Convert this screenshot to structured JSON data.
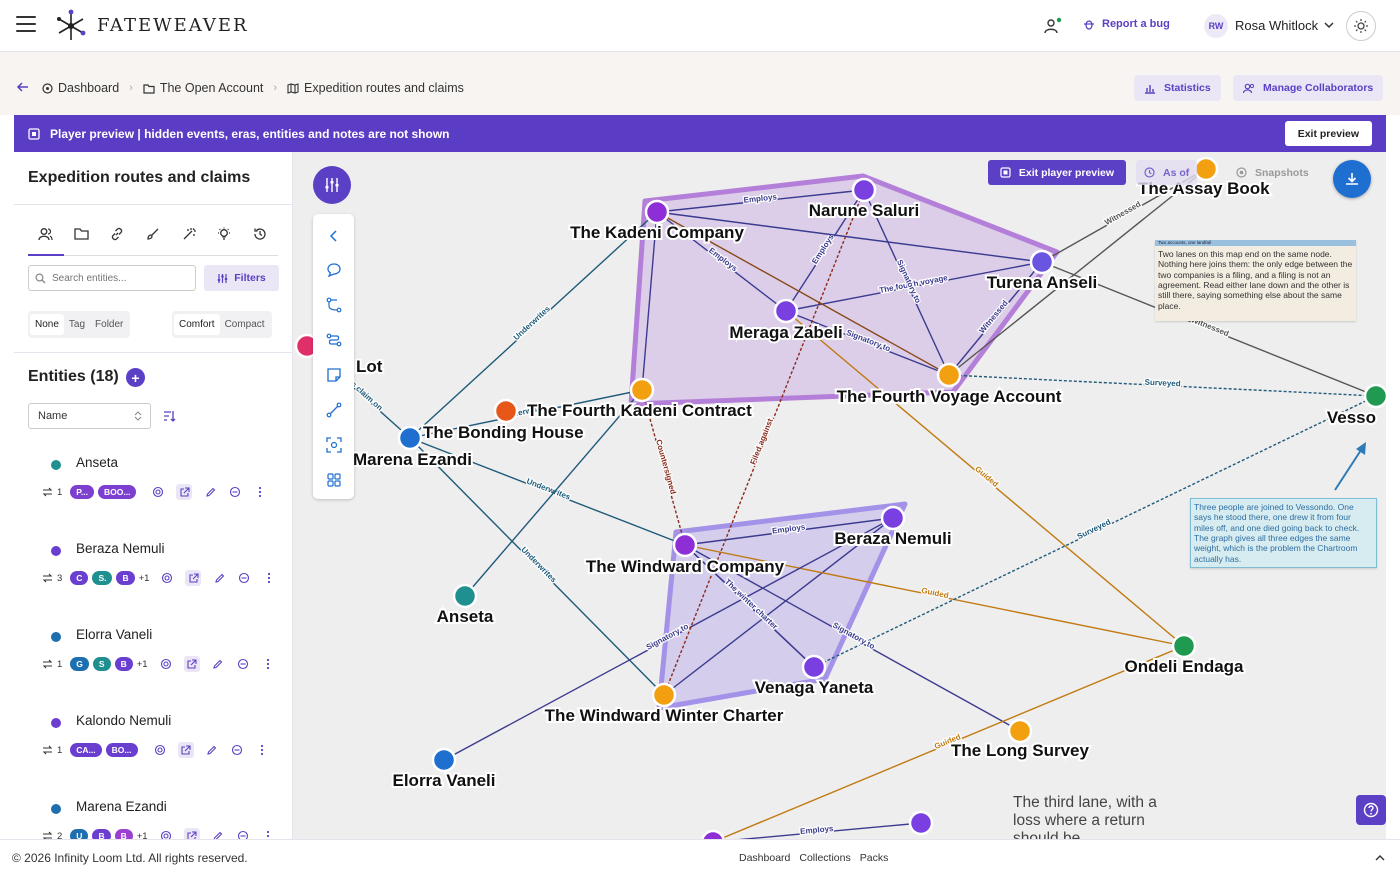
{
  "app": {
    "name": "FATEWEAVER",
    "user_initials": "RW",
    "user_name": "Rosa Whitlock",
    "report_bug": "Report a bug"
  },
  "breadcrumb": {
    "items": [
      "Dashboard",
      "The Open Account",
      "Expedition routes and claims"
    ],
    "statistics": "Statistics",
    "manage_collaborators": "Manage Collaborators"
  },
  "banner": {
    "text": "Player preview | hidden events, eras, entities and notes are not shown",
    "exit_label": "Exit preview"
  },
  "sidebar": {
    "title": "Expedition routes and claims",
    "search_placeholder": "Search entities...",
    "filters_label": "Filters",
    "group_options": [
      "None",
      "Tag",
      "Folder"
    ],
    "group_selected": "None",
    "density_options": [
      "Comfort",
      "Compact"
    ],
    "density_selected": "Comfort",
    "entities_heading": "Entities (18)",
    "sort_value": "Name",
    "entities": [
      {
        "name": "Anseta",
        "color": "#1f8f8f",
        "links": "1",
        "pills": [
          {
            "text": "P...",
            "color": "#7c3fd0"
          },
          {
            "text": "BOO...",
            "color": "#7c3fd0"
          }
        ],
        "more": ""
      },
      {
        "name": "Beraza Nemuli",
        "color": "#6a3fd0",
        "links": "3",
        "pills": [
          {
            "text": "C",
            "color": "#6a3fd0"
          },
          {
            "text": "S.",
            "color": "#1f8f8f"
          },
          {
            "text": "B",
            "color": "#6a3fd0"
          }
        ],
        "more": "+1"
      },
      {
        "name": "Elorra Vaneli",
        "color": "#1e6fb0",
        "links": "1",
        "pills": [
          {
            "text": "G",
            "color": "#1e6fb0"
          },
          {
            "text": "S",
            "color": "#1f8f8f"
          },
          {
            "text": "B",
            "color": "#6a3fd0"
          }
        ],
        "more": "+1"
      },
      {
        "name": "Kalondo Nemuli",
        "color": "#6a3fd0",
        "links": "1",
        "pills": [
          {
            "text": "CA...",
            "color": "#6a3fd0"
          },
          {
            "text": "BO...",
            "color": "#6a3fd0"
          }
        ],
        "more": ""
      },
      {
        "name": "Marena Ezandi",
        "color": "#1e6fb0",
        "links": "2",
        "pills": [
          {
            "text": "U",
            "color": "#1e6fb0"
          },
          {
            "text": "B",
            "color": "#6a3fd0"
          },
          {
            "text": "B",
            "color": "#9b3fd0"
          }
        ],
        "more": "+1"
      }
    ]
  },
  "canvas": {
    "exit_player_preview": "Exit player preview",
    "as_of": "As of",
    "snapshots": "Snapshots",
    "note1_header": "Two accounts, one landfall",
    "note1_text": "Two lanes on this map end on the same node. Nothing here joins them: the only edge between the two companies is a filing, and a filing is not an agreement. Read either lane down and the other is still there, saying something else about the same place.",
    "note2_text": "Three people are joined to Vessondo. One says he stood there, one drew it from four miles off, and one died going back to check. The graph gives all three edges the same weight, which is the problem the Chartroom actually has.",
    "big_note": "The third lane, with a loss where a return should be",
    "nodes": [
      {
        "id": "kadeni",
        "label": "The Kadeni Company",
        "color": "#8e2ed6"
      },
      {
        "id": "narune",
        "label": "Narune Saluri",
        "color": "#7a3fe0"
      },
      {
        "id": "turena",
        "label": "Turena Anseli",
        "color": "#6a55e0"
      },
      {
        "id": "meraga",
        "label": "Meraga Zabeli",
        "color": "#7a3fe0"
      },
      {
        "id": "fourthcontract",
        "label": "The Fourth Kadeni Contract",
        "color": "#f2a010"
      },
      {
        "id": "fourthvoyage",
        "label": "The Fourth Voyage Account",
        "color": "#f2a010"
      },
      {
        "id": "assay",
        "label": "The Assay Book",
        "color": "#f2a010"
      },
      {
        "id": "vesso",
        "label": "Vesso",
        "color": "#1f9a50"
      },
      {
        "id": "bonding",
        "label": "The Bonding House",
        "color": "#1e6fd0"
      },
      {
        "id": "marena",
        "label": "Marena Ezandi",
        "color": "#1e6fd0"
      },
      {
        "id": "orange",
        "label": "",
        "color": "#e8571a"
      },
      {
        "id": "pink",
        "label": "",
        "color": "#e0306a"
      },
      {
        "id": "lot",
        "label": "Lot",
        "color": ""
      },
      {
        "id": "windward",
        "label": "The Windward Company",
        "color": "#8e2ed6"
      },
      {
        "id": "beraza",
        "label": "Beraza Nemuli",
        "color": "#7a3fe0"
      },
      {
        "id": "venaga",
        "label": "Venaga Yaneta",
        "color": "#7a3fe0"
      },
      {
        "id": "winter",
        "label": "The Windward Winter Charter",
        "color": "#f2a010"
      },
      {
        "id": "anseta",
        "label": "Anseta",
        "color": "#1f8f8f"
      },
      {
        "id": "ondeli",
        "label": "Ondeli Endaga",
        "color": "#1f9a50"
      },
      {
        "id": "longsurvey",
        "label": "The Long Survey",
        "color": "#f2a010"
      },
      {
        "id": "elorra",
        "label": "Elorra Vaneli",
        "color": "#1e6fd0"
      },
      {
        "id": "bottomA",
        "label": "",
        "color": "#7a3fe0"
      },
      {
        "id": "bottomB",
        "label": "",
        "color": "#8e2ed6"
      }
    ],
    "edges": [
      {
        "from": "kadeni",
        "to": "narune",
        "label": "Employs",
        "color": "#3b3b8f"
      },
      {
        "from": "narune",
        "to": "meraga",
        "label": "Employs",
        "color": "#3b3b8f"
      },
      {
        "from": "kadeni",
        "to": "turena",
        "label": "",
        "color": "#3b3b8f"
      },
      {
        "from": "kadeni",
        "to": "meraga",
        "label": "Employs",
        "color": "#3b3b8f"
      },
      {
        "from": "meraga",
        "to": "turena",
        "label": "The fourth voyage",
        "color": "#3b3b8f"
      },
      {
        "from": "narune",
        "to": "fourthvoyage",
        "label": "Signatory to",
        "color": "#3b3b8f"
      },
      {
        "from": "meraga",
        "to": "fourthvoyage",
        "label": "Signatory to",
        "color": "#3b3b8f"
      },
      {
        "from": "turena",
        "to": "fourthvoyage",
        "label": "Witnessed",
        "color": "#3b3b8f"
      },
      {
        "from": "turena",
        "to": "assay",
        "label": "Witnessed",
        "color": "#555"
      },
      {
        "from": "turena",
        "to": "vesso",
        "label": "Witnessed",
        "color": "#555"
      },
      {
        "from": "fourthvoyage",
        "to": "assay",
        "label": "",
        "color": "#555"
      },
      {
        "from": "kadeni",
        "to": "fourthcontract",
        "label": "",
        "color": "#3b3b8f"
      },
      {
        "from": "kadeni",
        "to": "fourthvoyage",
        "label": "",
        "color": "#8a4a1a"
      },
      {
        "from": "bonding",
        "to": "kadeni",
        "label": "Underwrites",
        "color": "#1e5a7a"
      },
      {
        "from": "bonding",
        "to": "fourthcontract",
        "label": "Underwrites",
        "color": "#1e5a7a"
      },
      {
        "from": "bonding",
        "to": "windward",
        "label": "Underwrites",
        "color": "#1e5a7a"
      },
      {
        "from": "bonding",
        "to": "winter",
        "label": "Underwrites",
        "color": "#1e5a7a"
      },
      {
        "from": "pink",
        "to": "bonding",
        "label": "Holds claim on",
        "color": "#1e5a7a"
      },
      {
        "from": "fourthcontract",
        "to": "windward",
        "label": "Countersigned",
        "color": "#8a2a1a"
      },
      {
        "from": "meraga",
        "to": "ondeli",
        "label": "Guided",
        "color": "#c07a10"
      },
      {
        "from": "fourthvoyage",
        "to": "vesso",
        "label": "Surveyed",
        "color": "#1e5a7a"
      },
      {
        "from": "windward",
        "to": "beraza",
        "label": "Employs",
        "color": "#3b3b8f"
      },
      {
        "from": "windward",
        "to": "venaga",
        "label": "",
        "color": "#3b3b8f"
      },
      {
        "from": "beraza",
        "to": "winter",
        "label": "",
        "color": "#3b3b8f"
      },
      {
        "from": "windward",
        "to": "ondeli",
        "label": "Guided",
        "color": "#c07a10"
      },
      {
        "from": "venaga",
        "to": "vesso",
        "label": "Surveyed",
        "color": "#1e5a7a"
      },
      {
        "from": "anseta",
        "to": "fourthcontract",
        "label": "",
        "color": "#1e5a7a"
      },
      {
        "from": "windward",
        "to": "longsurvey",
        "label": "Signatory to",
        "color": "#3b3b8f"
      },
      {
        "from": "elorra",
        "to": "beraza",
        "label": "Signatory to",
        "color": "#3b3b8f"
      },
      {
        "from": "ondeli",
        "to": "bottomB",
        "label": "Guided",
        "color": "#c07a10"
      },
      {
        "from": "bottomB",
        "to": "bottomA",
        "label": "Employs",
        "color": "#3b3b8f"
      },
      {
        "from": "narune",
        "to": "winter",
        "label": "Filed against",
        "color": "#8a2a1a"
      },
      {
        "from": "windward",
        "to": "venaga",
        "label": "The winter charter",
        "color": "#3b3b8f"
      }
    ]
  },
  "footer": {
    "copyright": "© 2026 Infinity Loom Ltd. All rights reserved.",
    "links": [
      "Dashboard",
      "Collections",
      "Packs"
    ]
  }
}
